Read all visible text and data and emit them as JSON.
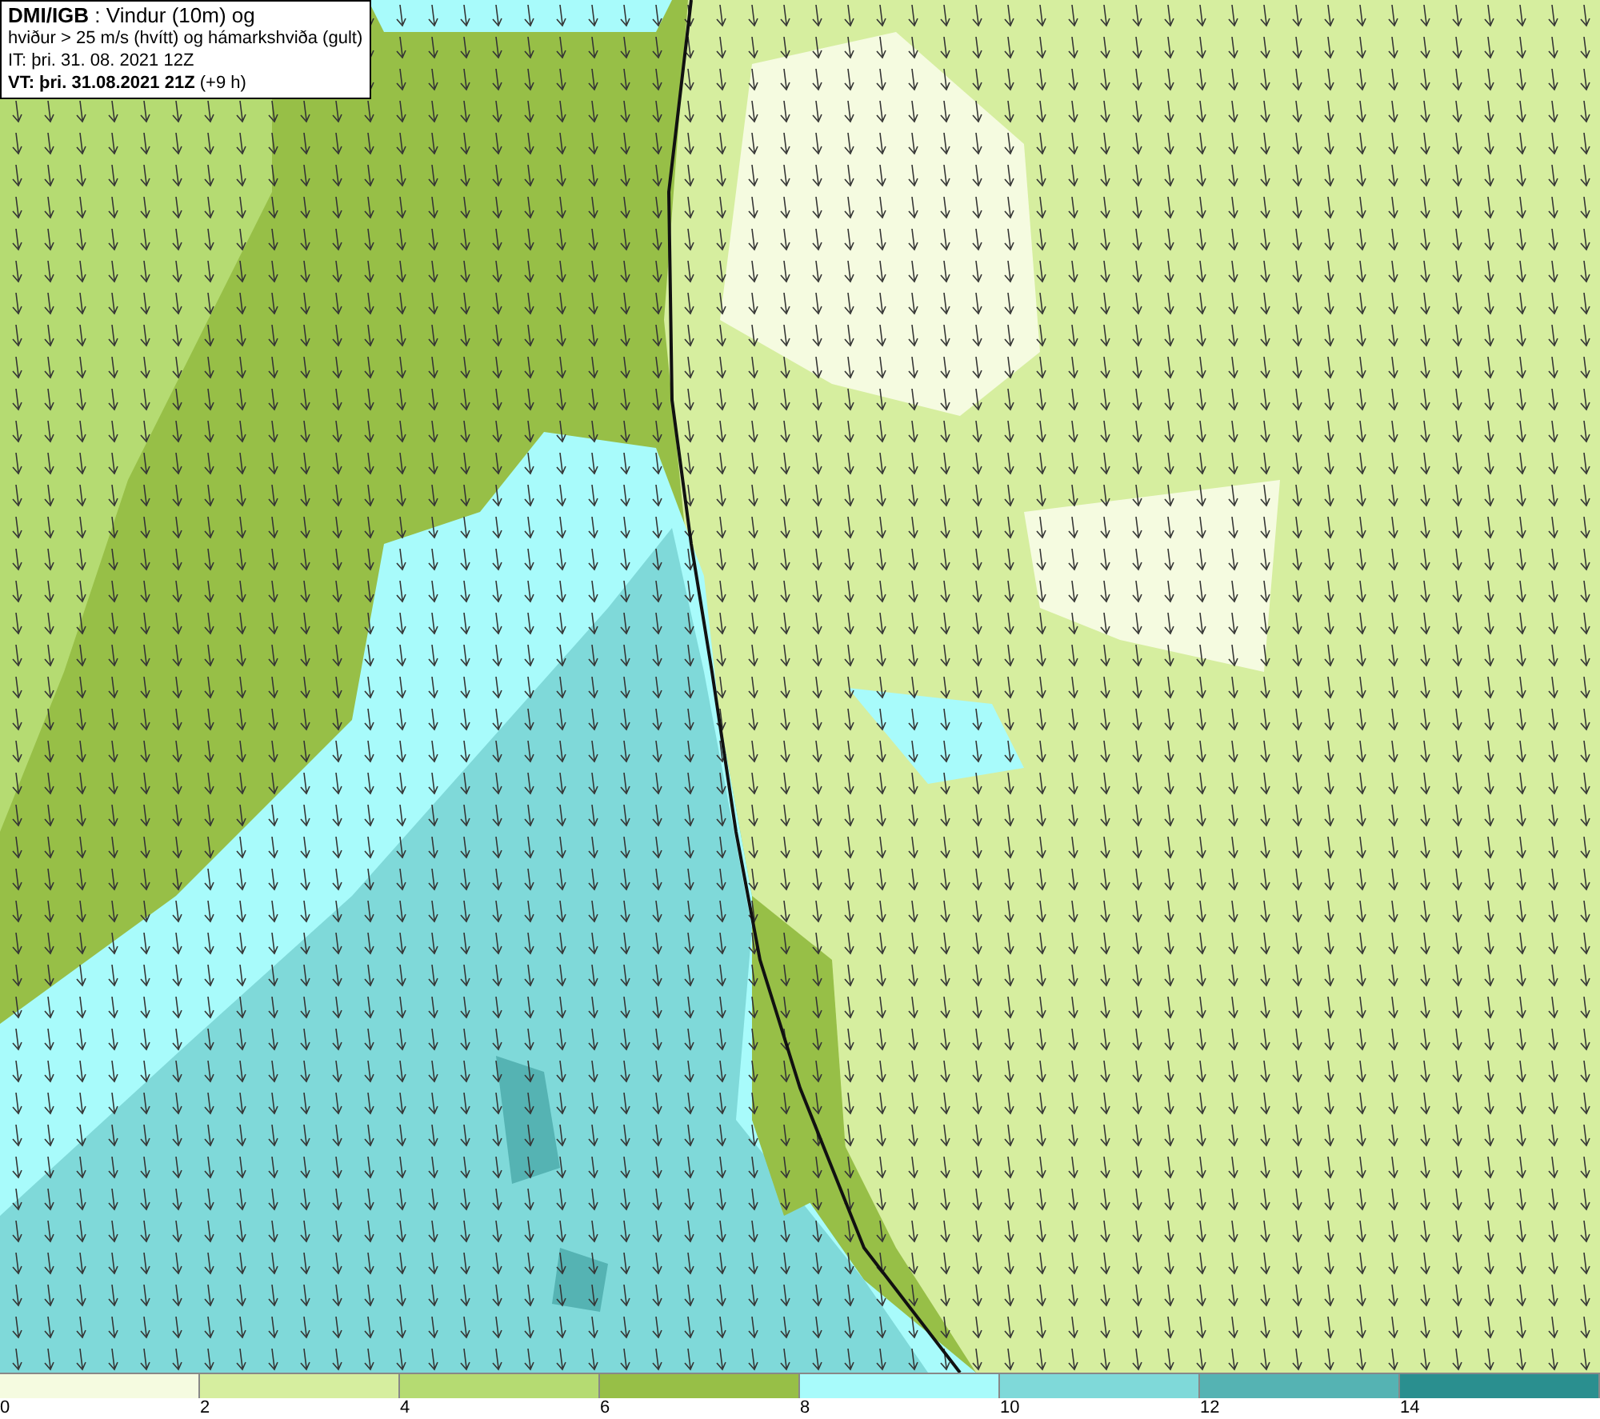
{
  "info_box": {
    "lines": [
      "**DMI/IGB** : Vindur (10m) og",
      "hviður > 25 m/s (hvítt) og hámarkshviða (gult)",
      "IT: þri. 31. 08. 2021 12Z",
      "**VT: þri. 31.08.2021 21Z** (+9 h)"
    ]
  },
  "legend": [
    {
      "label": "0",
      "color": "#f5fbe0"
    },
    {
      "label": "2",
      "color": "#d6ee9f"
    },
    {
      "label": "4",
      "color": "#b5db72"
    },
    {
      "label": "6",
      "color": "#97bf47"
    },
    {
      "label": "8",
      "color": "#a8fbfb"
    },
    {
      "label": "10",
      "color": "#7fd9d9"
    },
    {
      "label": "12",
      "color": "#55b3b3"
    },
    {
      "label": "14",
      "color": "#2a8f8f"
    }
  ]
}
